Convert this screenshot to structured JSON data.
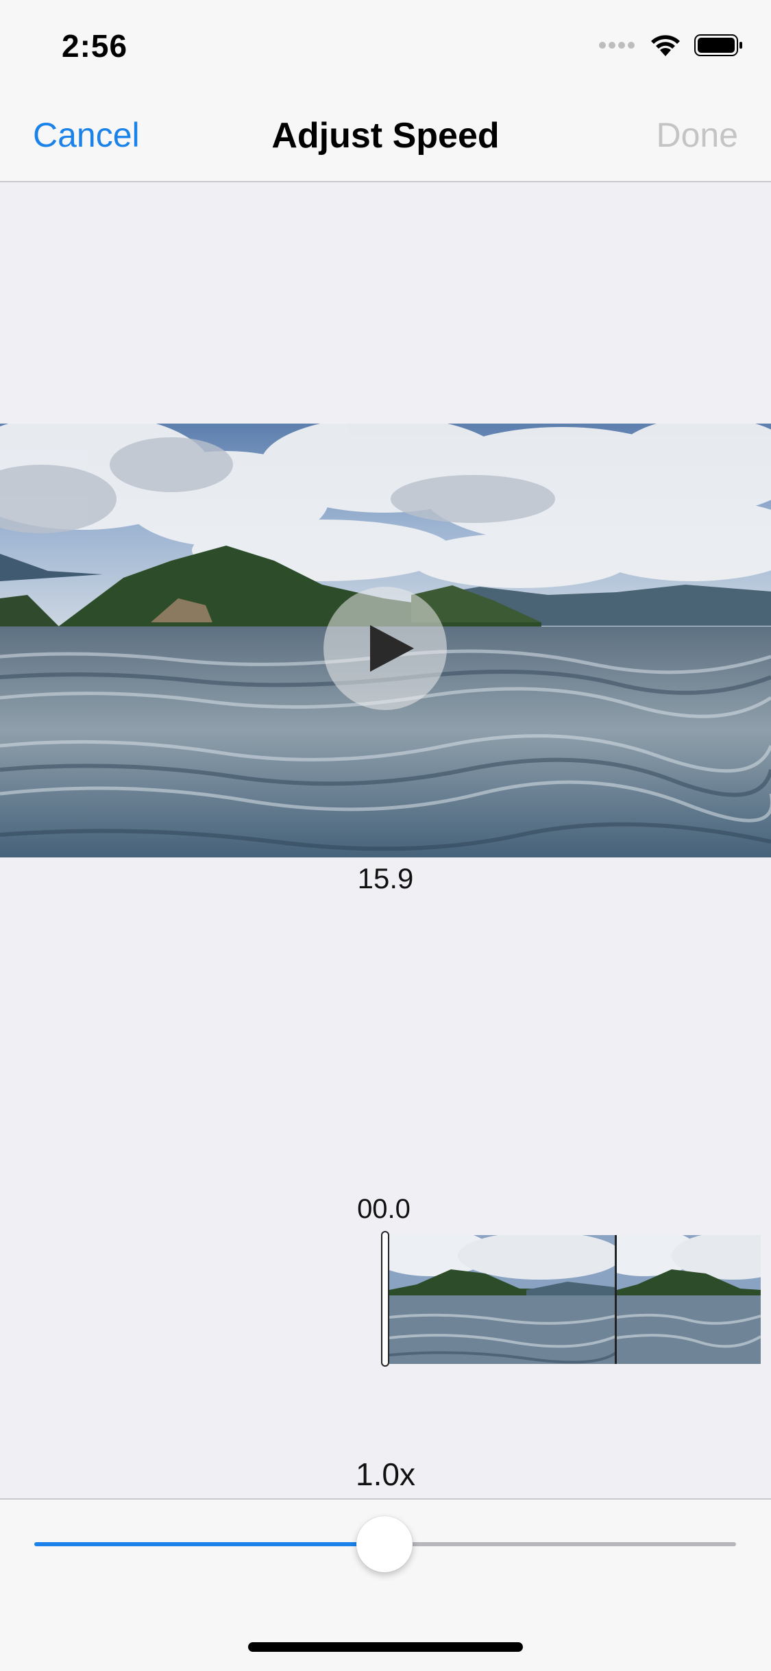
{
  "status_bar": {
    "time": "2:56",
    "icons": [
      "signal-dots-icon",
      "wifi-icon",
      "battery-icon"
    ]
  },
  "nav": {
    "cancel_label": "Cancel",
    "title": "Adjust Speed",
    "done_label": "Done"
  },
  "video": {
    "duration": "15.9",
    "play_icon": "play-icon"
  },
  "timeline": {
    "current_time": "00.0",
    "frame_count": 2
  },
  "speed": {
    "label": "1.0x",
    "slider_fraction": 0.5
  },
  "colors": {
    "accent": "#1a82e8",
    "disabled": "#c4c4c6",
    "background": "#efeff4",
    "bar": "#f7f7f7"
  }
}
